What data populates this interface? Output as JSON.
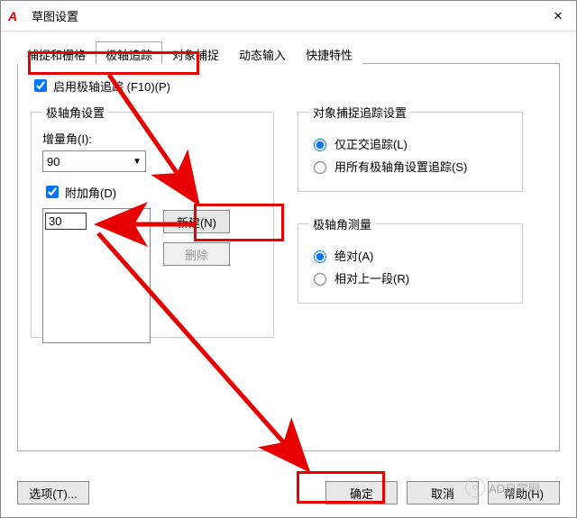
{
  "window": {
    "app_icon_text": "A",
    "title": "草图设置",
    "close": "✕"
  },
  "tabs": {
    "t0": "捕捉和栅格",
    "t1": "极轴追踪",
    "t2": "对象捕捉",
    "t3": "动态输入",
    "t4": "快捷特性"
  },
  "polar": {
    "enable_label": "启用极轴追踪 (F10)(P)",
    "group_title": "极轴角设置",
    "increment_label": "增量角(I):",
    "increment_value": "90",
    "additional_label": "附加角(D)",
    "additional_value": "30",
    "new_btn": "新建(N)",
    "delete_btn": "删除"
  },
  "track": {
    "group_title": "对象捕捉追踪设置",
    "opt1": "仅正交追踪(L)",
    "opt2": "用所有极轴角设置追踪(S)"
  },
  "measure": {
    "group_title": "极轴角测量",
    "opt1": "绝对(A)",
    "opt2": "相对上一段(R)"
  },
  "footer": {
    "options": "选项(T)...",
    "ok": "确定",
    "cancel": "取消",
    "help": "帮助(H)"
  },
  "watermark": "AD自学网"
}
